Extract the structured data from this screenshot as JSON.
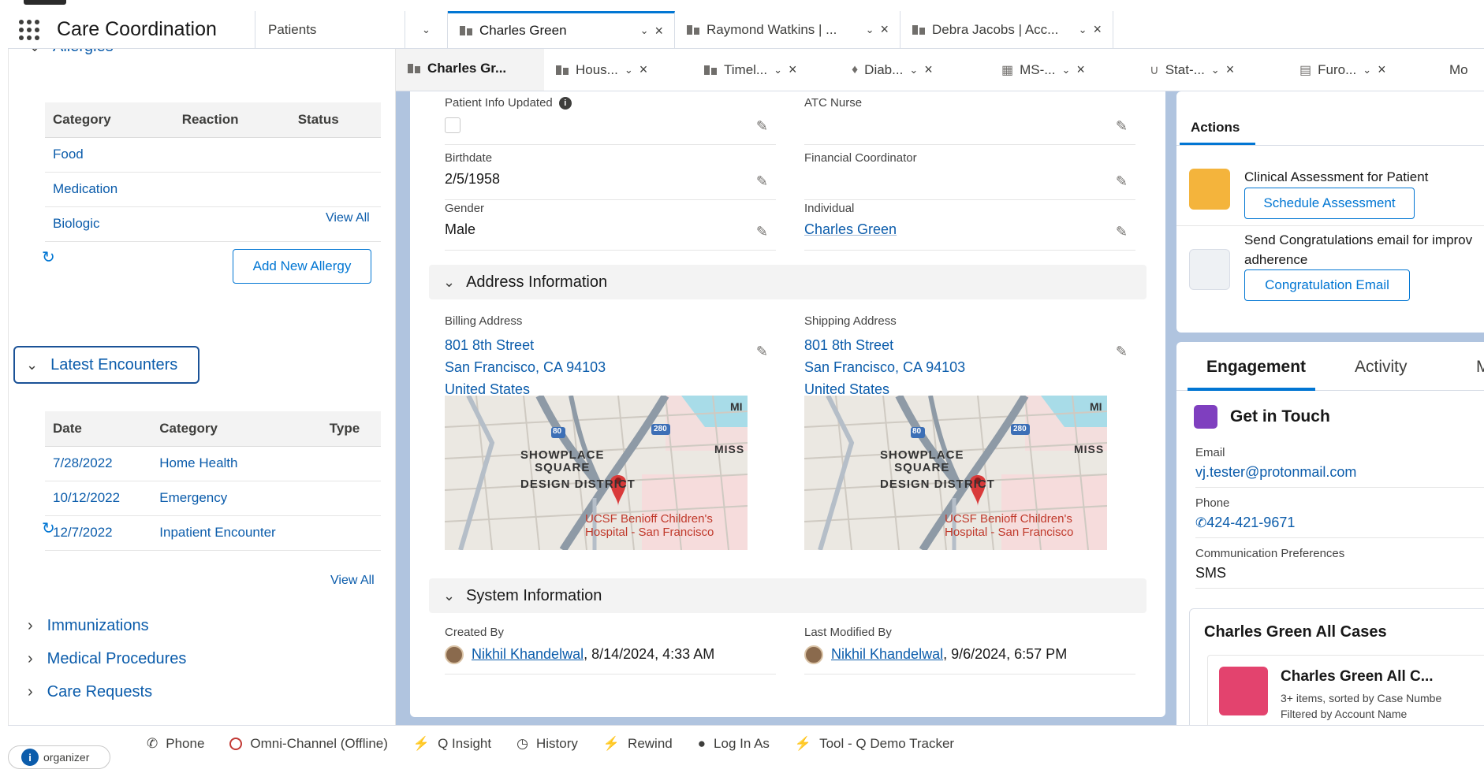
{
  "header": {
    "app_title": "Care Coordination",
    "nav_select": "Patients",
    "tabs": [
      {
        "label": "Charles Green"
      },
      {
        "label": "Raymond Watkins | ..."
      },
      {
        "label": "Debra Jacobs | Acc..."
      }
    ]
  },
  "subtabs": [
    {
      "label": "Charles Gr..."
    },
    {
      "label": "Hous..."
    },
    {
      "label": "Timel..."
    },
    {
      "label": "Diab..."
    },
    {
      "label": "MS-..."
    },
    {
      "label": "Stat-..."
    },
    {
      "label": "Furo..."
    },
    {
      "label": "Mo"
    }
  ],
  "left": {
    "allergies": {
      "title": "Allergies",
      "columns": [
        "Category",
        "Reaction",
        "Status"
      ],
      "rows": [
        "Food",
        "Medication",
        "Biologic"
      ],
      "view_all": "View All",
      "add_button": "Add New Allergy"
    },
    "encounters": {
      "title": "Latest Encounters",
      "columns": [
        "Date",
        "Category",
        "Type"
      ],
      "rows": [
        {
          "date": "7/28/2022",
          "category": "Home Health"
        },
        {
          "date": "10/12/2022",
          "category": "Emergency"
        },
        {
          "date": "12/7/2022",
          "category": "Inpatient Encounter"
        }
      ],
      "view_all": "View All"
    },
    "collapsed": [
      "Immunizations",
      "Medical Procedures",
      "Care Requests"
    ]
  },
  "details": {
    "patient_info_updated": "Patient Info Updated",
    "atc_nurse": "ATC Nurse",
    "birthdate_label": "Birthdate",
    "birthdate": "2/5/1958",
    "financial_coordinator": "Financial Coordinator",
    "gender_label": "Gender",
    "gender": "Male",
    "individual_label": "Individual",
    "individual": "Charles Green",
    "address_section": "Address Information",
    "billing_label": "Billing Address",
    "shipping_label": "Shipping Address",
    "address_line1": "801 8th Street",
    "address_line2": "San Francisco, CA 94103",
    "address_line3": "United States",
    "map_labels": {
      "showplace1": "SHOWPLACE",
      "showplace2": "SQUARE",
      "district": "DESIGN DISTRICT",
      "miss": "MISS",
      "mi": "MI",
      "ucsf1": "UCSF Benioff Children's",
      "ucsf2": "Hospital - San Francisco",
      "hwy80": "80",
      "hwy280": "280"
    },
    "system_section": "System Information",
    "created_by_label": "Created By",
    "created_by_name": "Nikhil Khandelwal",
    "created_by_date": ", 8/14/2024, 4:33 AM",
    "modified_by_label": "Last Modified By",
    "modified_by_name": "Nikhil Khandelwal",
    "modified_by_date": ", 9/6/2024, 6:57 PM"
  },
  "actions": {
    "title": "Actions",
    "item1_text": "Clinical Assessment for Patient",
    "item1_button": "Schedule Assessment",
    "item2_text_a": "Send Congratulations email for improv",
    "item2_text_b": "adherence",
    "item2_button": "Congratulation Email"
  },
  "engagement": {
    "tab_engagement": "Engagement",
    "tab_activity": "Activity",
    "tab_more": "M",
    "get_in_touch": "Get in Touch",
    "email_label": "Email",
    "email": "vj.tester@protonmail.com",
    "phone_label": "Phone",
    "phone": "424-421-9671",
    "comm_label": "Communication Preferences",
    "comm": "SMS",
    "cases_title": "Charles Green All Cases",
    "case_name": "Charles Green All C...",
    "case_meta1": "3+ items, sorted by Case Numbe",
    "case_meta2": "Filtered by Account Name"
  },
  "utility": {
    "items": [
      "Phone",
      "Omni-Channel (Offline)",
      "Q Insight",
      "History",
      "Rewind",
      "Log In As",
      "Tool - Q Demo Tracker"
    ],
    "organizer": "organizer"
  },
  "colors": {
    "brand_blue": "#0176d3",
    "link": "#0b5cab",
    "page_bg": "#b0c4df",
    "action_icon": "#f4b43c",
    "case_icon": "#e3436e",
    "get_in_touch_icon": "#7f3fbf"
  }
}
